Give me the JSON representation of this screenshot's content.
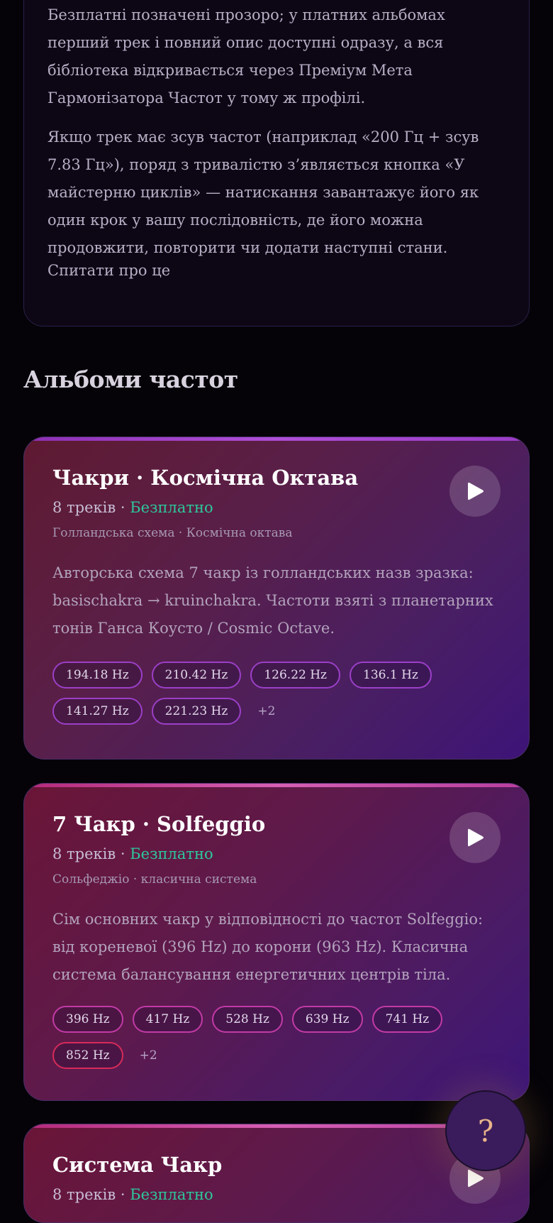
{
  "info": {
    "p1": "Безплатні позначені прозоро; у платних альбомах перший трек і повний опис доступні одразу, а вся бібліотека відкривається через Преміум Мета Гармонізатора Частот у тому ж профілі.",
    "p2": "Якщо трек має зсув частот (наприклад «200 Гц + зсув 7.83 Гц»), поряд з тривалістю з’являється кнопка «У майстерню циклів» — натискання завантажує його як один крок у вашу послідовність, де його можна продовжити, повторити чи додати наступні стани.",
    "ask_label": "Спитати про це"
  },
  "section_title": "Альбоми частот",
  "albums": [
    {
      "title": "Чакри · Космічна Октава",
      "tracks": "8 треків",
      "sep": " · ",
      "price": "Безплатно",
      "subtitle": "Голландська схема · Космічна октава",
      "description": "Авторська схема 7 чакр із голландських назв зразка: basischakra → kruinchakra. Частоти взяті з планетарних тонів Ганса Коусто / Cosmic Octave.",
      "chips": [
        "194.18 Hz",
        "210.42 Hz",
        "126.22 Hz",
        "136.1 Hz",
        "141.27 Hz",
        "221.23 Hz"
      ],
      "more": "+2"
    },
    {
      "title": "7 Чакр · Solfeggio",
      "tracks": "8 треків",
      "sep": " · ",
      "price": "Безплатно",
      "subtitle": "Сольфеджіо · класична система",
      "description": "Сім основних чакр у відповідності до частот Solfeggio: від кореневої (396 Hz) до корони (963 Hz). Класична система балансування енергетичних центрів тіла.",
      "chips": [
        "396 Hz",
        "417 Hz",
        "528 Hz",
        "639 Hz",
        "741 Hz",
        "852 Hz"
      ],
      "more": "+2"
    },
    {
      "title": "Система Чакр",
      "tracks": "8 треків",
      "sep": " · ",
      "price": "Безплатно"
    }
  ],
  "help_label": "?",
  "colors": {
    "accent_free": "#2ec79a",
    "background": "#050308"
  },
  "icons": {
    "play": "play-icon",
    "help": "question-icon"
  }
}
